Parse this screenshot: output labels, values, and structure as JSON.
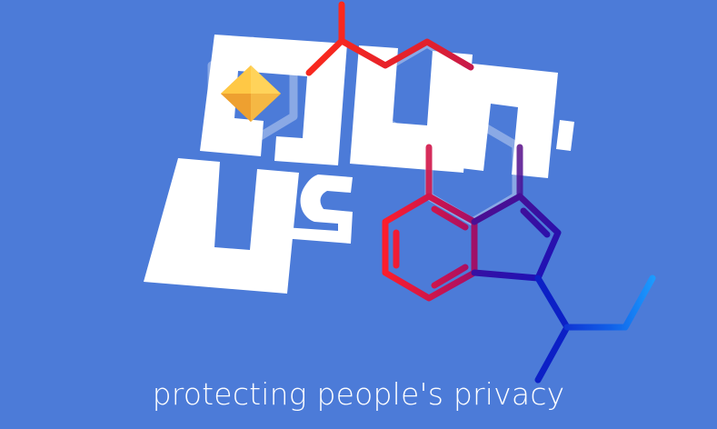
{
  "banner": {
    "tagline": "protecting people's privacy",
    "background_color": "#4c7bd8"
  },
  "logo": {
    "name": "gun.js",
    "icon": "diamond-gem-icon",
    "colors": {
      "letters": "#ffffff",
      "gem_light": "#ffd45a",
      "gem_dark": "#f0a932"
    }
  },
  "molecule": {
    "icon": "molecule-structure-icon",
    "gradient": [
      "#ff2a1a",
      "#e01a3a",
      "#7a0f7a",
      "#1a1ab8",
      "#0a2ed0",
      "#1a8cff"
    ],
    "ghost_color": "#ffffff"
  }
}
